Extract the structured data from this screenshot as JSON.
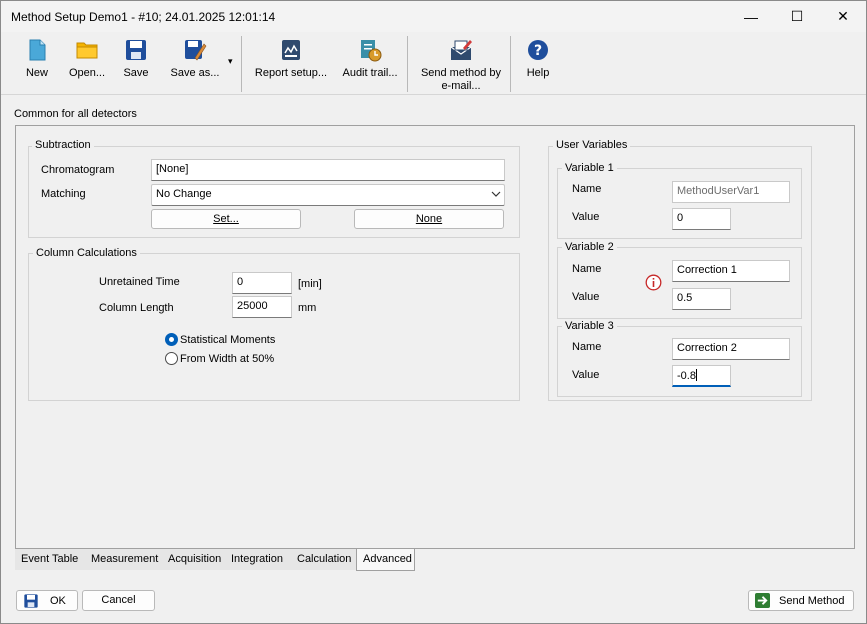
{
  "window": {
    "title": "Method Setup Demo1 - #10;   24.01.2025   12:01:14",
    "minimize": "—",
    "maximize": "☐",
    "close": "✕"
  },
  "toolbar": {
    "new": "New",
    "open": "Open...",
    "save": "Save",
    "save_as": "Save as...",
    "dropdown": "▾",
    "report_setup": "Report setup...",
    "audit_trail": "Audit trail...",
    "send_email_line1": "Send method by",
    "send_email_line2": "e-mail...",
    "help": "Help"
  },
  "section_title": "Common for all detectors",
  "subtraction": {
    "title": "Subtraction",
    "chromatogram_label": "Chromatogram",
    "chromatogram_value": "[None]",
    "matching_label": "Matching",
    "matching_value": "No Change",
    "set_button": "Set...",
    "none_button": "None"
  },
  "column_calc": {
    "title": "Column Calculations",
    "unretained_label": "Unretained Time",
    "unretained_value": "0",
    "unretained_unit": "[min]",
    "length_label": "Column Length",
    "length_value": "25000",
    "length_unit": "mm",
    "radio_statistical": "Statistical Moments",
    "radio_width": "From Width at 50%"
  },
  "user_vars": {
    "title": "User Variables",
    "name_label": "Name",
    "value_label": "Value",
    "var1": {
      "title": "Variable 1",
      "name": "MethodUserVar1",
      "value": "0"
    },
    "var2": {
      "title": "Variable 2",
      "name": "Correction 1",
      "value": "0.5"
    },
    "var3": {
      "title": "Variable 3",
      "name": "Correction 2",
      "value": "-0.8"
    }
  },
  "tabs": [
    "Event Table",
    "Measurement",
    "Acquisition",
    "Integration",
    "Calculation",
    "Advanced"
  ],
  "footer": {
    "ok": "OK",
    "cancel": "Cancel",
    "send_method": "Send Method"
  }
}
